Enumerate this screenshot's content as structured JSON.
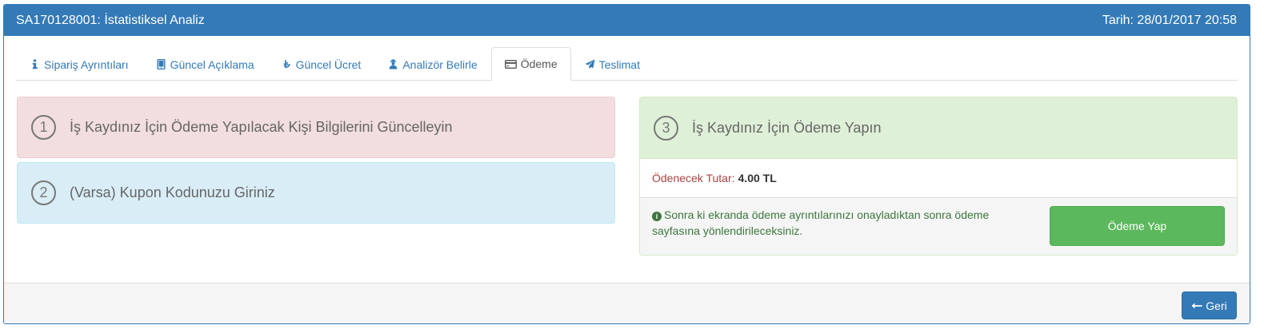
{
  "header": {
    "title": "SA170128001: İstatistiksel Analiz",
    "date": "Tarih: 28/01/2017 20:58"
  },
  "tabs": [
    {
      "label": "Sipariş Ayrıntıları",
      "icon": "info-icon"
    },
    {
      "label": "Güncel Açıklama",
      "icon": "tablet-icon"
    },
    {
      "label": "Güncel Ücret",
      "icon": "lira-icon"
    },
    {
      "label": "Analizör Belirle",
      "icon": "user-secret-icon"
    },
    {
      "label": "Ödeme",
      "icon": "credit-card-icon",
      "active": true
    },
    {
      "label": "Teslimat",
      "icon": "paper-plane-icon"
    }
  ],
  "steps": {
    "step1": {
      "number": "1",
      "title": "İş Kaydınız İçin Ödeme Yapılacak Kişi Bilgilerini Güncelleyin"
    },
    "step2": {
      "number": "2",
      "title": "(Varsa) Kupon Kodunuzu Giriniz"
    },
    "step3": {
      "number": "3",
      "title": "İş Kaydınız İçin Ödeme Yapın"
    }
  },
  "payment": {
    "amount_label": "Ödenecek Tutar:",
    "amount_value": "4.00 TL",
    "info": "Sonra ki ekranda ödeme ayrıntılarınızı onayladıktan sonra ödeme sayfasına yönlendirileceksiniz.",
    "pay_button": "Ödeme Yap"
  },
  "footer": {
    "back_button": "Geri"
  },
  "colors": {
    "primary": "#337ab7",
    "danger_bg": "#f2dede",
    "info_bg": "#d9edf7",
    "success_bg": "#dff0d8",
    "success_btn": "#5cb85c"
  }
}
